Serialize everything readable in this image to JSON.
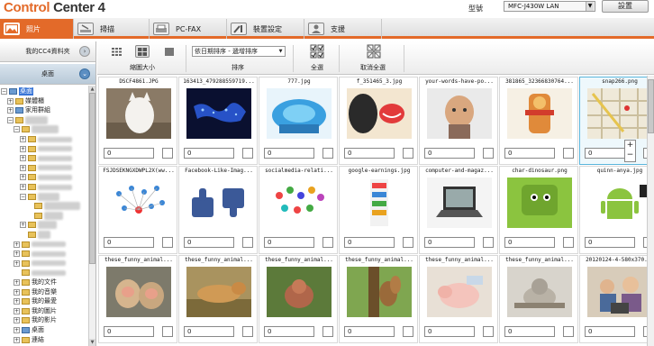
{
  "app": {
    "logo_main": "Control",
    "logo_rest": " Center 4"
  },
  "header": {
    "model_label": "型號",
    "model_value": "MFC-J430W LAN",
    "settings_label": "設置"
  },
  "tabs": [
    {
      "label": "照片",
      "icon": "photo-icon",
      "active": true
    },
    {
      "label": "掃描",
      "icon": "scanner-icon",
      "active": false
    },
    {
      "label": "PC-FAX",
      "icon": "fax-icon",
      "active": false
    },
    {
      "label": "裝置設定",
      "icon": "tools-icon",
      "active": false
    },
    {
      "label": "支援",
      "icon": "user-icon",
      "active": false
    }
  ],
  "left_panel": {
    "my_content": "我的CC4資料夾",
    "desktop": "桌面",
    "tree": [
      {
        "label": "桌面",
        "level": 0,
        "exp": "−",
        "folder": "blue",
        "selected": true,
        "blur": false
      },
      {
        "label": "媒體櫃",
        "level": 1,
        "exp": "+",
        "folder": "yellow",
        "selected": false,
        "blur": false
      },
      {
        "label": "家用群組",
        "level": 1,
        "exp": "+",
        "folder": "blue",
        "selected": false,
        "blur": false
      },
      {
        "label": "Martha",
        "level": 1,
        "exp": "−",
        "folder": "yellow",
        "selected": false,
        "blur": true
      },
      {
        "label": "Dropbox",
        "level": 2,
        "exp": "−",
        "folder": "yellow",
        "selected": false,
        "blur": true
      },
      {
        "label": "",
        "level": 3,
        "exp": "+",
        "folder": "yellow",
        "selected": false,
        "blur": true
      },
      {
        "label": "",
        "level": 3,
        "exp": "+",
        "folder": "yellow",
        "selected": false,
        "blur": true
      },
      {
        "label": "",
        "level": 3,
        "exp": "+",
        "folder": "yellow",
        "selected": false,
        "blur": true
      },
      {
        "label": "",
        "level": 3,
        "exp": "+",
        "folder": "yellow",
        "selected": false,
        "blur": true
      },
      {
        "label": "",
        "level": 3,
        "exp": "+",
        "folder": "yellow",
        "selected": false,
        "blur": true
      },
      {
        "label": "",
        "level": 3,
        "exp": "+",
        "folder": "yellow",
        "selected": false,
        "blur": true
      },
      {
        "label": "Photos",
        "level": 3,
        "exp": "−",
        "folder": "yellow",
        "selected": false,
        "blur": true
      },
      {
        "label": "Sample Alb",
        "level": 4,
        "exp": "",
        "folder": "yellow",
        "selected": false,
        "blur": true
      },
      {
        "label": "Vinter",
        "level": 4,
        "exp": "",
        "folder": "yellow",
        "selected": false,
        "blur": true
      },
      {
        "label": "Public",
        "level": 3,
        "exp": "+",
        "folder": "yellow",
        "selected": false,
        "blur": true
      },
      {
        "label": "文件",
        "level": 3,
        "exp": "",
        "folder": "yellow",
        "selected": false,
        "blur": true
      },
      {
        "label": "",
        "level": 2,
        "exp": "+",
        "folder": "yellow",
        "selected": false,
        "blur": true
      },
      {
        "label": "",
        "level": 2,
        "exp": "+",
        "folder": "yellow",
        "selected": false,
        "blur": true
      },
      {
        "label": "",
        "level": 2,
        "exp": "+",
        "folder": "yellow",
        "selected": false,
        "blur": true
      },
      {
        "label": "",
        "level": 2,
        "exp": "",
        "folder": "yellow",
        "selected": false,
        "blur": true
      },
      {
        "label": "我的文件",
        "level": 2,
        "exp": "+",
        "folder": "yellow",
        "selected": false,
        "blur": false
      },
      {
        "label": "我的音樂",
        "level": 2,
        "exp": "+",
        "folder": "yellow",
        "selected": false,
        "blur": false
      },
      {
        "label": "我的最愛",
        "level": 2,
        "exp": "+",
        "folder": "yellow",
        "selected": false,
        "blur": false
      },
      {
        "label": "我的圖片",
        "level": 2,
        "exp": "+",
        "folder": "yellow",
        "selected": false,
        "blur": false
      },
      {
        "label": "我的影片",
        "level": 2,
        "exp": "+",
        "folder": "yellow",
        "selected": false,
        "blur": false
      },
      {
        "label": "桌面",
        "level": 2,
        "exp": "+",
        "folder": "blue",
        "selected": false,
        "blur": false
      },
      {
        "label": "連結",
        "level": 2,
        "exp": "+",
        "folder": "yellow",
        "selected": false,
        "blur": false
      }
    ]
  },
  "toolbar": {
    "thumb_size_label": "縮圖大小",
    "sort_label": "排序",
    "sort_value": "依日期排序 - 遞增排序",
    "select_all_label": "全選",
    "deselect_all_label": "取消全選"
  },
  "photos": [
    {
      "name": "DSCF4861.JPG",
      "qty": "0",
      "kind": "cat",
      "selected": false
    },
    {
      "name": "163413_479288559719...",
      "qty": "0",
      "kind": "map",
      "selected": false
    },
    {
      "name": "777.jpg",
      "qty": "0",
      "kind": "chart",
      "selected": false
    },
    {
      "name": "f_351465_3.jpg",
      "qty": "0",
      "kind": "comic",
      "selected": false
    },
    {
      "name": "your-words-have-po...",
      "qty": "0",
      "kind": "kid",
      "selected": false
    },
    {
      "name": "381865_32366830764...",
      "qty": "0",
      "kind": "deity",
      "selected": false
    },
    {
      "name": "snap266.png",
      "qty": "0",
      "kind": "citymap",
      "selected": true
    },
    {
      "name": "FSJDSEKNGXDWPL2X(ww...",
      "qty": "0",
      "kind": "network",
      "selected": false
    },
    {
      "name": "Facebook-Like-Imag...",
      "qty": "0",
      "kind": "thumbs",
      "selected": false
    },
    {
      "name": "socialmedia-relati...",
      "qty": "0",
      "kind": "crowd",
      "selected": false
    },
    {
      "name": "google-earnings.jpg",
      "qty": "0",
      "kind": "infographic",
      "selected": false
    },
    {
      "name": "computer-and-magaz...",
      "qty": "0",
      "kind": "laptop",
      "selected": false
    },
    {
      "name": "char-dinosaur.png",
      "qty": "0",
      "kind": "dino",
      "selected": false
    },
    {
      "name": "quinn-anya.jpg",
      "qty": "0",
      "kind": "android",
      "selected": false
    },
    {
      "name": "these_funny_animal...",
      "qty": "0",
      "kind": "monkeys",
      "selected": false
    },
    {
      "name": "these_funny_animal...",
      "qty": "0",
      "kind": "dog",
      "selected": false
    },
    {
      "name": "these_funny_animal...",
      "qty": "0",
      "kind": "animal",
      "selected": false
    },
    {
      "name": "these_funny_animal...",
      "qty": "0",
      "kind": "squirrel",
      "selected": false
    },
    {
      "name": "these_funny_animal...",
      "qty": "0",
      "kind": "piglet",
      "selected": false
    },
    {
      "name": "these_funny_animal...",
      "qty": "0",
      "kind": "cat2",
      "selected": false
    },
    {
      "name": "20120124-4-580x370...",
      "qty": "0",
      "kind": "family",
      "selected": false
    }
  ],
  "zoom": {
    "plus": "+",
    "minus": "−"
  },
  "colors": {
    "accent": "#e36a29",
    "selection": "#5ab6dc"
  }
}
